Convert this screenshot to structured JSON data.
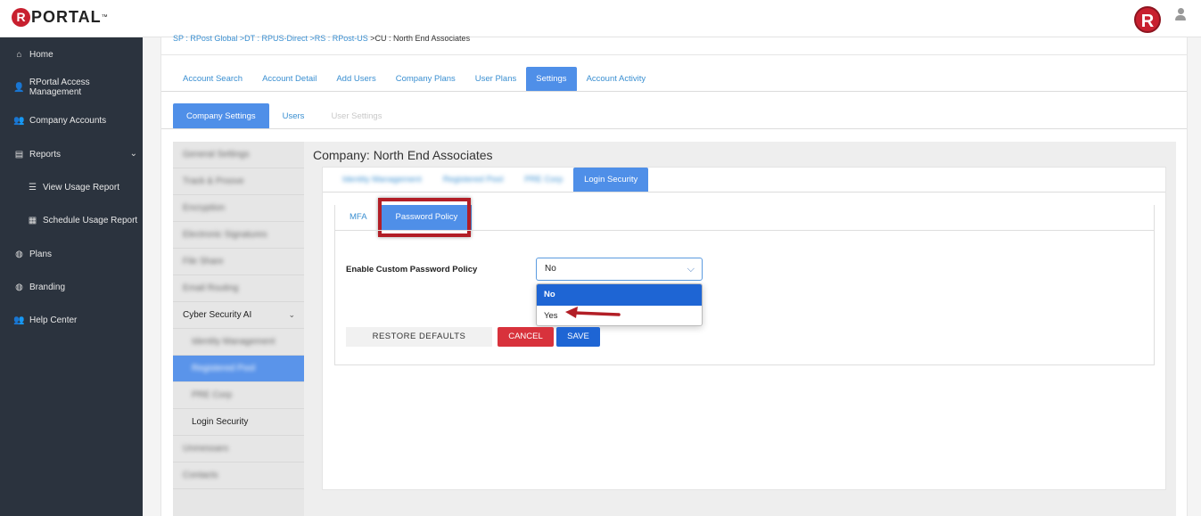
{
  "header": {
    "logo_initial": "R",
    "logo_text": "PORTAL",
    "logo_tm": "™",
    "brand_icon_letter": "R"
  },
  "sidebar": {
    "items": [
      {
        "icon": "home-icon",
        "glyph": "⌂",
        "label": "Home"
      },
      {
        "icon": "user-plus-icon",
        "glyph": "👤",
        "label": "RPortal Access Management"
      },
      {
        "icon": "users-icon",
        "glyph": "👥",
        "label": "Company Accounts"
      },
      {
        "icon": "bar-chart-icon",
        "glyph": "▤",
        "label": "Reports"
      },
      {
        "icon": "list-icon",
        "glyph": "☰",
        "label": "View Usage Report"
      },
      {
        "icon": "calendar-icon",
        "glyph": "▦",
        "label": "Schedule Usage Report"
      },
      {
        "icon": "globe-icon",
        "glyph": "◍",
        "label": "Plans"
      },
      {
        "icon": "globe-icon",
        "glyph": "◍",
        "label": "Branding"
      },
      {
        "icon": "users-icon",
        "glyph": "👥",
        "label": "Help Center"
      }
    ],
    "reports_chevron": "⌄"
  },
  "breadcrumb": {
    "part1": "SP : RPost Global",
    "part2": " >DT : RPUS-Direct",
    "part3": " >RS : RPost-US",
    "part4": " >CU : North End Associates"
  },
  "main_tabs": [
    "Account Search",
    "Account Detail",
    "Add Users",
    "Company Plans",
    "User Plans",
    "Settings",
    "Account Activity"
  ],
  "settings_tabs": [
    "Company Settings",
    "Users",
    "User Settings"
  ],
  "left_nav": {
    "items": [
      "General Settings",
      "Track & Proove",
      "Encryption",
      "Electronic Signatures",
      "File Share",
      "Email Routing",
      "Cyber Security AI",
      "Identity Management",
      "Registered Pool",
      "PRE Corp",
      "Login Security",
      "Unmessaro",
      "Contacts"
    ],
    "chevron": "⌄"
  },
  "company_title": "Company: North End Associates",
  "security_tabs": [
    "Identity Management",
    "Registered Pool",
    "PRE Corp",
    "Login Security"
  ],
  "login_security_tabs": [
    "MFA",
    "Password Policy"
  ],
  "form": {
    "label": "Enable Custom Password Policy",
    "selected_value": "No",
    "options": [
      "No",
      "Yes"
    ],
    "chevron": "⌵"
  },
  "buttons": {
    "restore": "RESTORE DEFAULTS",
    "cancel": "CANCEL",
    "save": "SAVE"
  },
  "colors": {
    "brand_red": "#c8202f",
    "accent_blue": "#4f8fe8",
    "sidebar_bg": "#2b333e",
    "highlight_red": "#b21e26"
  }
}
